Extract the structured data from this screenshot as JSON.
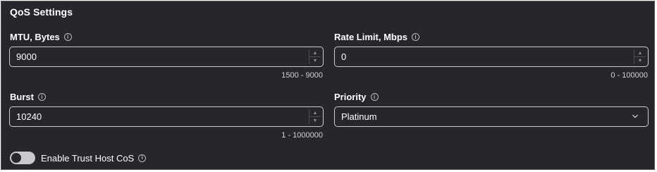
{
  "section": {
    "title": "QoS Settings"
  },
  "mtu": {
    "label": "MTU, Bytes",
    "value": "9000",
    "range": "1500 - 9000"
  },
  "rate_limit": {
    "label": "Rate Limit, Mbps",
    "value": "0",
    "range": "0 - 100000"
  },
  "burst": {
    "label": "Burst",
    "value": "10240",
    "range": "1 - 1000000"
  },
  "priority": {
    "label": "Priority",
    "selected": "Platinum"
  },
  "trust_host_cos": {
    "label": "Enable Trust Host CoS",
    "enabled": false
  },
  "icons": {
    "info": "info-icon",
    "chevron": "chevron-down-icon",
    "spin_up": "spin-up-icon",
    "spin_down": "spin-down-icon"
  }
}
